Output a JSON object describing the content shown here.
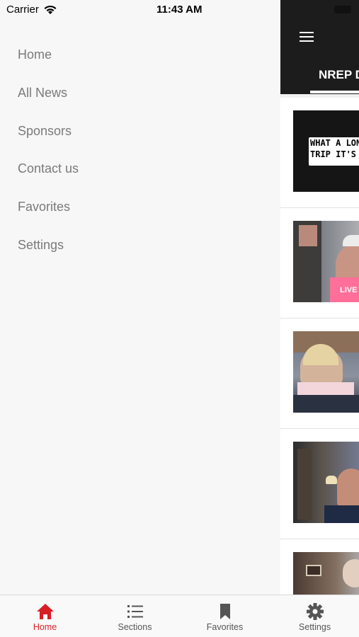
{
  "status_bar": {
    "carrier": "Carrier",
    "time": "11:43 AM"
  },
  "drawer": {
    "items": [
      {
        "label": "Home"
      },
      {
        "label": "All News"
      },
      {
        "label": "Sponsors"
      },
      {
        "label": "Contact us"
      },
      {
        "label": "Favorites"
      },
      {
        "label": "Settings"
      }
    ]
  },
  "main": {
    "tab_label": "NREP D",
    "thumbnails": [
      {
        "caption_line1": "WHAT A LONG S",
        "caption_line2": "TRIP IT'S B"
      },
      {
        "shirt_text": "LIVE"
      }
    ]
  },
  "tab_bar": {
    "tabs": [
      {
        "label": "Home",
        "icon": "home-icon",
        "active": true
      },
      {
        "label": "Sections",
        "icon": "list-icon",
        "active": false
      },
      {
        "label": "Favorites",
        "icon": "bookmark-icon",
        "active": false
      },
      {
        "label": "Settings",
        "icon": "gear-icon",
        "active": false
      }
    ]
  },
  "colors": {
    "accent": "#d81f26",
    "app_bar": "#1c1c1c",
    "drawer_bg": "#f7f7f7",
    "drawer_text": "#7a7a7a"
  }
}
